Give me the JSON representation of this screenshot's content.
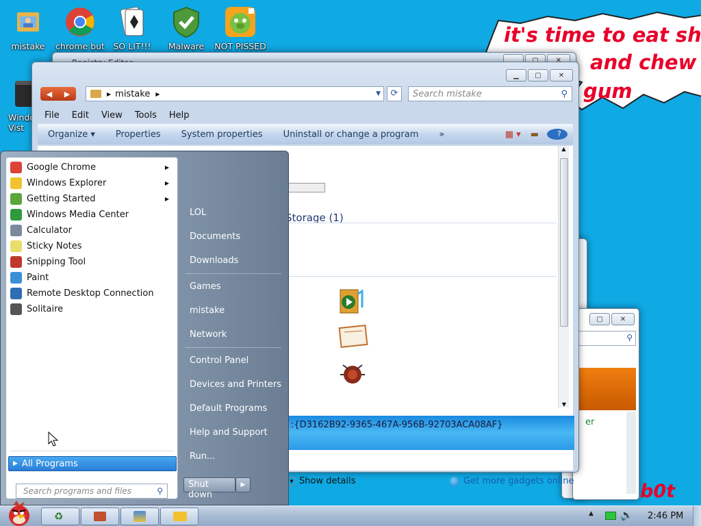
{
  "desktop_icons": [
    {
      "label": "mistake",
      "icon": "user-folder-icon"
    },
    {
      "label": "chrome but",
      "icon": "chrome-icon"
    },
    {
      "label": "SO LIT!!!",
      "icon": "solitaire-icon"
    },
    {
      "label": "Malware",
      "icon": "shield-check-icon"
    },
    {
      "label": "NOT PISSED",
      "icon": "angry-pig-icon"
    },
    {
      "label": "Windo Vist",
      "icon": "recycle-bin-icon"
    }
  ],
  "speech_bubble": {
    "lines": [
      "it's time to eat shit",
      "and chew",
      "gum"
    ]
  },
  "background_windows": {
    "registry_title": "Registry Editor",
    "status_text": ":{D3162B92-9365-467A-956B-92703ACA08AF}",
    "content_partial": "Storage (1)",
    "show_details": "Show details",
    "get_gadgets": "Get more gadgets online",
    "bot_text": "b0t",
    "er_text": "er"
  },
  "explorer": {
    "address_path": "mistake",
    "search_placeholder": "Search mistake",
    "menu": [
      "File",
      "Edit",
      "View",
      "Tools",
      "Help"
    ],
    "commands": [
      "Organize ▾",
      "Properties",
      "System properties",
      "Uninstall or change a program",
      "»"
    ]
  },
  "start_menu": {
    "programs": [
      {
        "label": "Google Chrome",
        "icon": "chrome-icon",
        "submenu": true,
        "color": "#db4437"
      },
      {
        "label": "Windows Explorer",
        "icon": "folder-icon",
        "submenu": true,
        "color": "#f2c230"
      },
      {
        "label": "Getting Started",
        "icon": "windows-flag-icon",
        "submenu": true,
        "color": "#5aa63b"
      },
      {
        "label": "Windows Media Center",
        "icon": "media-center-icon",
        "submenu": false,
        "color": "#2e9a3c"
      },
      {
        "label": "Calculator",
        "icon": "calculator-icon",
        "submenu": false,
        "color": "#7a8a9c"
      },
      {
        "label": "Sticky Notes",
        "icon": "sticky-notes-icon",
        "submenu": false,
        "color": "#e9de6b"
      },
      {
        "label": "Snipping Tool",
        "icon": "scissors-icon",
        "submenu": false,
        "color": "#c0392b"
      },
      {
        "label": "Paint",
        "icon": "paint-icon",
        "submenu": false,
        "color": "#3b8fd8"
      },
      {
        "label": "Remote Desktop Connection",
        "icon": "remote-desktop-icon",
        "submenu": false,
        "color": "#2f6db5"
      },
      {
        "label": "Solitaire",
        "icon": "cards-icon",
        "submenu": false,
        "color": "#555555"
      }
    ],
    "all_programs": "All Programs",
    "search_placeholder": "Search programs and files",
    "right_items": [
      "LOL",
      "Documents",
      "Downloads",
      "Games",
      "mistake",
      "Network",
      "Control Panel",
      "Devices and Printers",
      "Default Programs",
      "Help and Support",
      "Run..."
    ],
    "shutdown": "Shut down"
  },
  "taskbar": {
    "start_icon": "angry-bird-icon",
    "clock": "2:46 PM"
  },
  "colors": {
    "desktop": "#0fa9e4",
    "bubble_text": "#e8002a",
    "selected_item": "#3a97e3"
  }
}
